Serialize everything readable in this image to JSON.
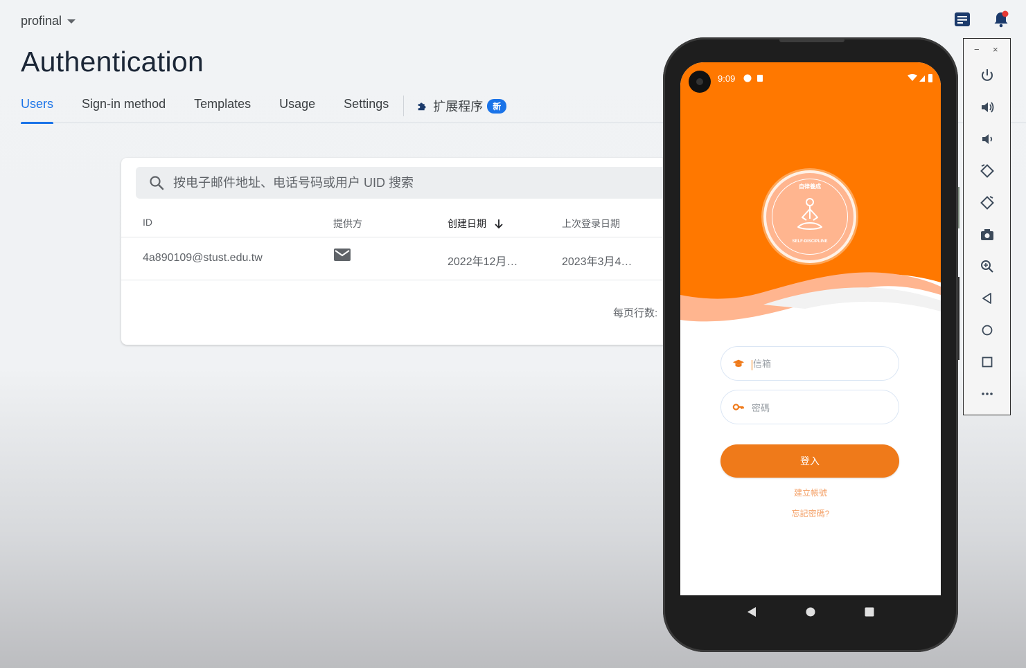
{
  "header": {
    "project_name": "profinal",
    "page_title": "Authentication",
    "icons": [
      "release-notes-icon",
      "notifications-icon"
    ]
  },
  "tabs": [
    {
      "label": "Users",
      "active": true
    },
    {
      "label": "Sign-in method",
      "active": false
    },
    {
      "label": "Templates",
      "active": false
    },
    {
      "label": "Usage",
      "active": false
    },
    {
      "label": "Settings",
      "active": false
    }
  ],
  "extensions_tab": {
    "label": "扩展程序",
    "badge": "新",
    "icon": "puzzle-icon"
  },
  "users_table": {
    "search_placeholder": "按电子邮件地址、电话号码或用户 UID 搜索",
    "columns": {
      "id": "ID",
      "provider": "提供方",
      "created": "创建日期",
      "last_signin": "上次登录日期"
    },
    "rows": [
      {
        "id": "4a890109@stust.edu.tw",
        "provider_icon": "mail-icon",
        "created": "2022年12月…",
        "last_signin": "2023年3月4…"
      }
    ],
    "rows_per_page_label": "每页行数:"
  },
  "phone": {
    "status_time": "9:09",
    "logo_top_text": "自律養成",
    "logo_bottom_text": "SELF-DISCIPLINE",
    "email_placeholder": "信箱",
    "password_placeholder": "密碼",
    "login_button": "登入",
    "register_link": "建立帳號",
    "forgot_link": "忘記密碼?",
    "accent_color": "#ff7800"
  },
  "emulator_controls": {
    "window_buttons": [
      "−",
      "×"
    ],
    "tools": [
      "power-icon",
      "volume-up-icon",
      "volume-down-icon",
      "rotate-left-icon",
      "rotate-right-icon",
      "camera-icon",
      "zoom-icon",
      "back-icon",
      "home-icon",
      "overview-icon",
      "more-icon"
    ]
  }
}
